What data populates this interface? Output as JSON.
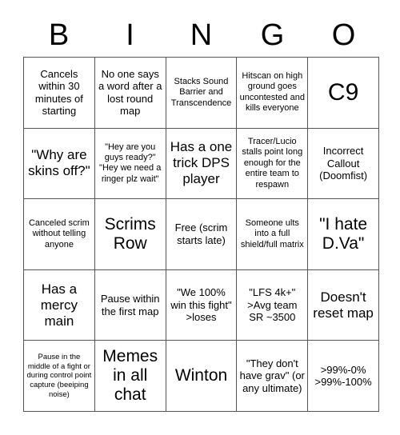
{
  "card": {
    "header_letters": [
      "B",
      "I",
      "N",
      "G",
      "O"
    ],
    "free_space_label": "Scrims Row",
    "rows": [
      [
        {
          "text": "Cancels within 30 minutes of starting",
          "size": "md"
        },
        {
          "text": "No one says a word after a lost round map",
          "size": "md"
        },
        {
          "text": "Stacks Sound Barrier and Transcendence",
          "size": "sm"
        },
        {
          "text": "Hitscan on high ground goes uncontested and kills everyone",
          "size": "sm"
        },
        {
          "text": "C9",
          "size": "xxl"
        }
      ],
      [
        {
          "text": "\"Why are skins off?\"",
          "size": "lg"
        },
        {
          "text": "\"Hey are you guys ready?\" \"Hey we need a ringer plz wait\"",
          "size": "sm"
        },
        {
          "text": "Has a one trick DPS player",
          "size": "lg"
        },
        {
          "text": "Tracer/Lucio stalls point long enough for the entire team to respawn",
          "size": "sm"
        },
        {
          "text": "Incorrect Callout (Doomfist)",
          "size": "md"
        }
      ],
      [
        {
          "text": "Canceled scrim without telling anyone",
          "size": "sm"
        },
        {
          "text": "Scrims Row",
          "size": "xl"
        },
        {
          "text": "Free (scrim starts late)",
          "size": "md"
        },
        {
          "text": "Someone ults into a full shield/full matrix",
          "size": "sm"
        },
        {
          "text": "\"I hate D.Va\"",
          "size": "xl"
        }
      ],
      [
        {
          "text": "Has a mercy main",
          "size": "lg"
        },
        {
          "text": "Pause within the first map",
          "size": "md"
        },
        {
          "text": "\"We 100% win this fight\" >loses",
          "size": "md"
        },
        {
          "text": "\"LFS 4k+\" >Avg team SR ~3500",
          "size": "md"
        },
        {
          "text": "Doesn't reset map",
          "size": "lg"
        }
      ],
      [
        {
          "text": "Pause in the middle of a fight or during control point capture (beeiping noise)",
          "size": "xs"
        },
        {
          "text": "Memes in all chat",
          "size": "xl"
        },
        {
          "text": "Winton",
          "size": "xl"
        },
        {
          "text": "\"They don't have grav\" (or any ultimate)",
          "size": "md"
        },
        {
          "text": ">99%-0% >99%-100%",
          "size": "md"
        }
      ]
    ]
  },
  "colors": {
    "background": "#ffffff",
    "text": "#000000",
    "grid_line": "#555555"
  }
}
